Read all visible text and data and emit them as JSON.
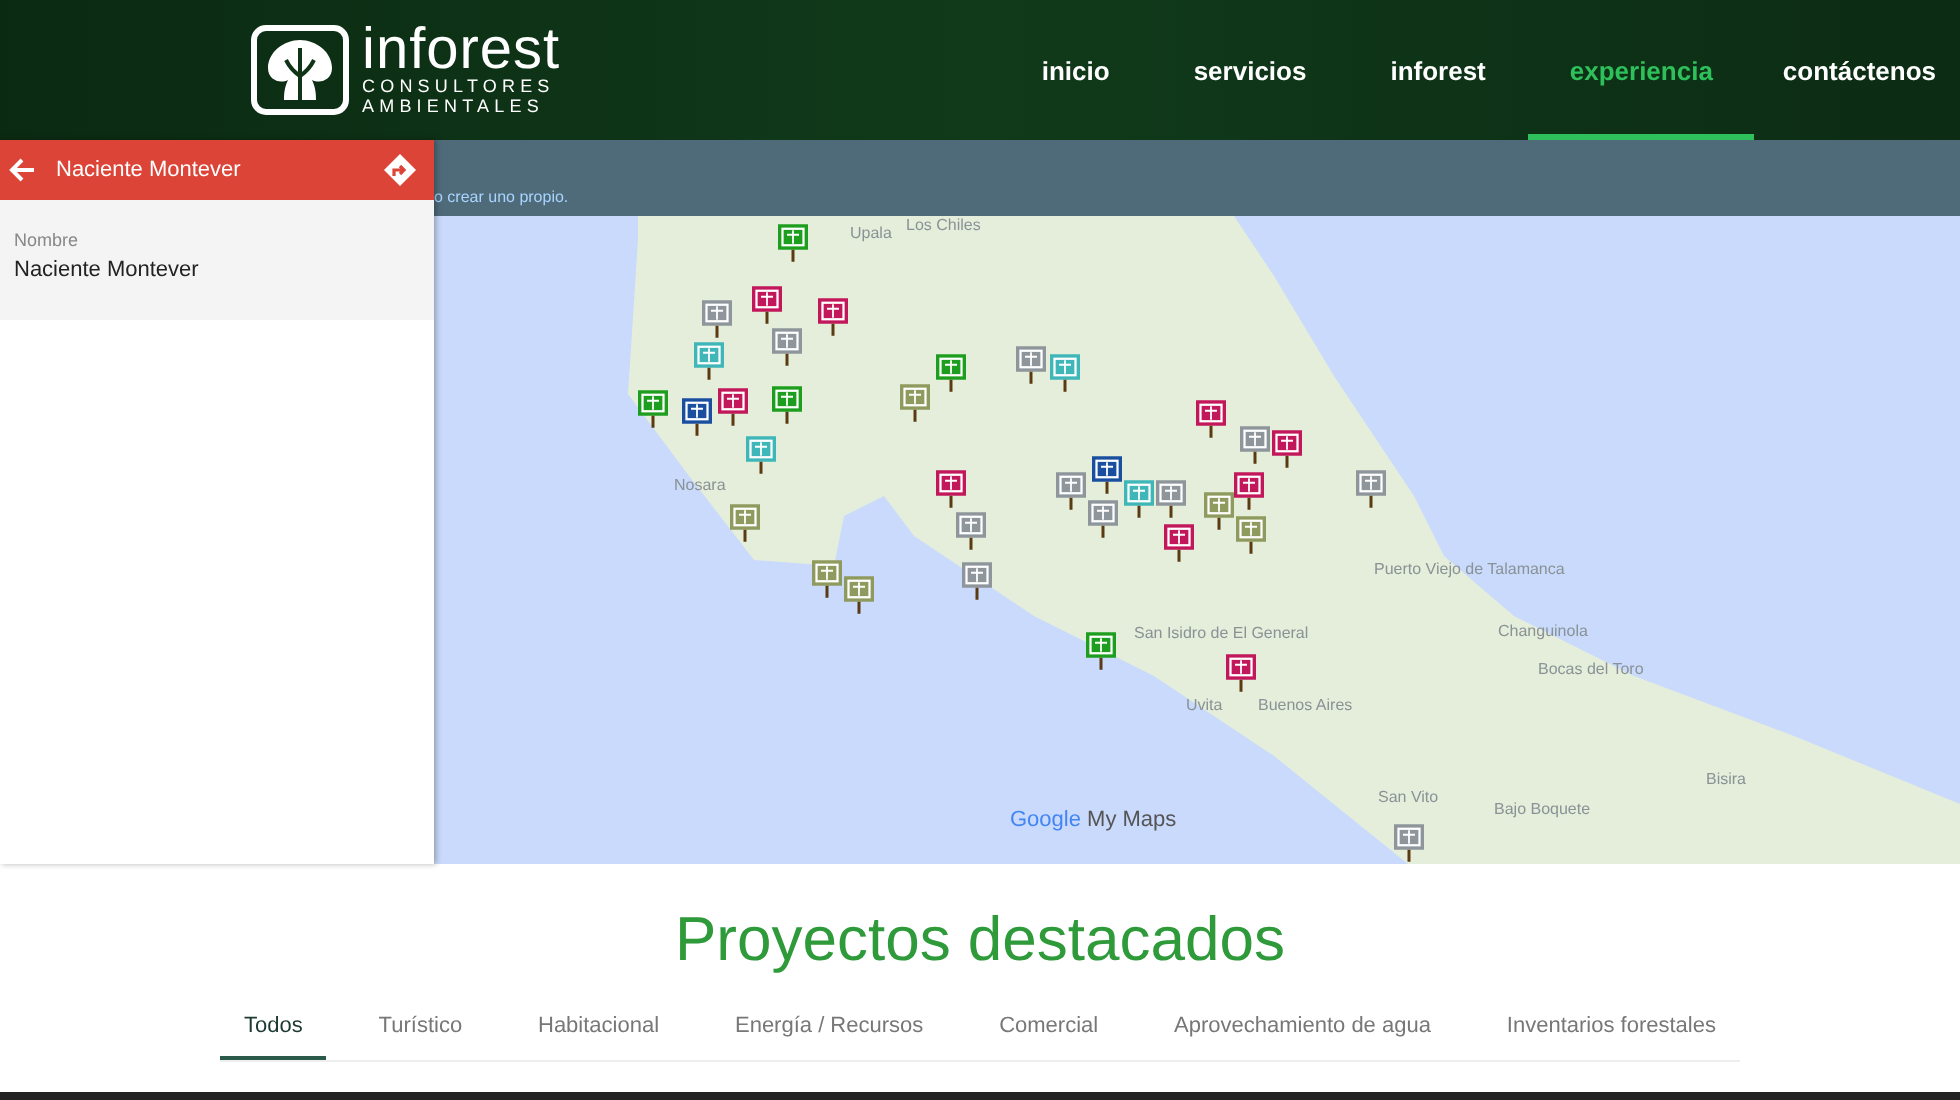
{
  "header": {
    "logo": {
      "name": "inforest",
      "tagline_1": "CONSULTORES",
      "tagline_2": "AMBIENTALES"
    },
    "nav": [
      {
        "label": "inicio",
        "selected": false
      },
      {
        "label": "servicios",
        "selected": false
      },
      {
        "label": "inforest",
        "selected": false
      },
      {
        "label": "experiencia",
        "selected": true
      },
      {
        "label": "contáctenos",
        "selected": false
      }
    ]
  },
  "side_panel": {
    "title": "Naciente Montever",
    "field_label": "Nombre",
    "field_value": "Naciente Montever"
  },
  "map_bar": {
    "text": "o crear uno propio."
  },
  "map": {
    "place_labels": [
      "Upala",
      "Los Chiles",
      "Nosara",
      "Puerto Viejo de Talamanca",
      "Changuinola",
      "Bocas del Toro",
      "San Isidro de El General",
      "Uvita",
      "Buenos Aires",
      "San Vito",
      "Bajo Boquete",
      "Bisira"
    ],
    "attribution": {
      "brand": "Google",
      "product": "My Maps"
    },
    "markers": [
      {
        "color": "#1e9e1e"
      },
      {
        "color": "#c2185b"
      },
      {
        "color": "#c2185b"
      },
      {
        "color": "#8e969c"
      },
      {
        "color": "#8e969c"
      },
      {
        "color": "#3fb6b8"
      },
      {
        "color": "#1e9e1e"
      },
      {
        "color": "#8e969c"
      },
      {
        "color": "#3fb6b8"
      },
      {
        "color": "#8f9a5e"
      },
      {
        "color": "#1e9e1e"
      },
      {
        "color": "#1a4fa0"
      },
      {
        "color": "#c2185b"
      },
      {
        "color": "#1e9e1e"
      },
      {
        "color": "#3fb6b8"
      },
      {
        "color": "#c2185b"
      },
      {
        "color": "#8e969c"
      },
      {
        "color": "#c2185b"
      },
      {
        "color": "#8e969c"
      },
      {
        "color": "#c2185b"
      },
      {
        "color": "#8e969c"
      },
      {
        "color": "#8e969c"
      },
      {
        "color": "#1a4fa0"
      },
      {
        "color": "#8e969c"
      },
      {
        "color": "#3fb6b8"
      },
      {
        "color": "#8e969c"
      },
      {
        "color": "#c2185b"
      },
      {
        "color": "#c2185b"
      },
      {
        "color": "#8f9a5e"
      },
      {
        "color": "#8f9a5e"
      },
      {
        "color": "#8f9a5e"
      },
      {
        "color": "#8f9a5e"
      },
      {
        "color": "#8f9a5e"
      },
      {
        "color": "#8e969c"
      },
      {
        "color": "#1e9e1e"
      },
      {
        "color": "#c2185b"
      },
      {
        "color": "#8e969c"
      }
    ]
  },
  "projects": {
    "title": "Proyectos destacados",
    "tabs": [
      {
        "label": "Todos",
        "selected": true
      },
      {
        "label": "Turístico",
        "selected": false
      },
      {
        "label": "Habitacional",
        "selected": false
      },
      {
        "label": "Energía / Recursos",
        "selected": false
      },
      {
        "label": "Comercial",
        "selected": false
      },
      {
        "label": "Aprovechamiento de agua",
        "selected": false
      },
      {
        "label": "Inventarios forestales",
        "selected": false
      }
    ]
  }
}
